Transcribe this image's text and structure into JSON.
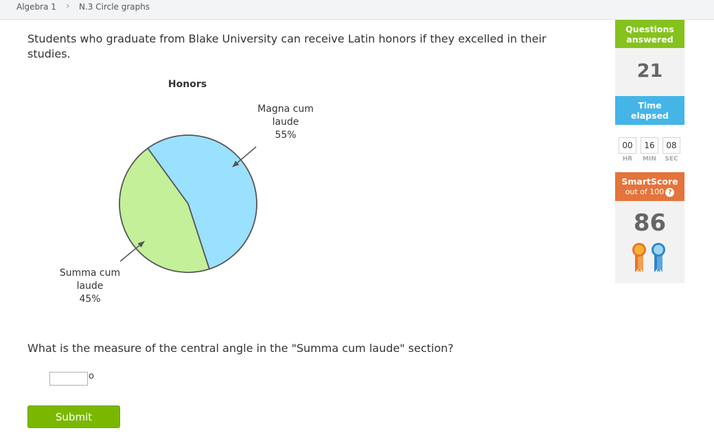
{
  "breadcrumb": {
    "course": "Algebra 1",
    "separator": "›",
    "skill": "N.3 Circle graphs"
  },
  "question": {
    "text": "Students who graduate from Blake University can receive Latin honors if they excelled in their studies.",
    "prompt": "What is the measure of the central angle in the \"Summa cum laude\" section?",
    "answer_value": "",
    "degree_symbol": "o",
    "submit_label": "Submit"
  },
  "chart_data": {
    "type": "pie",
    "title": "Honors",
    "categories": [
      "Magna cum laude",
      "Summa cum laude"
    ],
    "values": [
      55,
      45
    ],
    "unit": "%",
    "colors": [
      "#99e1ff",
      "#c4f09a"
    ],
    "labels": [
      {
        "lines": [
          "Magna cum",
          "laude",
          "55%"
        ]
      },
      {
        "lines": [
          "Summa cum",
          "laude",
          "45%"
        ]
      }
    ]
  },
  "sidebar": {
    "questions_answered": {
      "label_line1": "Questions",
      "label_line2": "answered",
      "count": "21",
      "color": "#85c21e"
    },
    "time_elapsed": {
      "label_line1": "Time",
      "label_line2": "elapsed",
      "color": "#45b5e8",
      "hours": "00",
      "minutes": "16",
      "seconds": "08",
      "hr_label": "HR",
      "min_label": "MIN",
      "sec_label": "SEC"
    },
    "smartscore": {
      "title": "SmartScore",
      "subtitle": "out of 100",
      "help": "?",
      "score": "86",
      "color": "#e3743b",
      "ribbons": [
        "orange-ribbon-icon",
        "blue-ribbon-icon"
      ]
    }
  }
}
